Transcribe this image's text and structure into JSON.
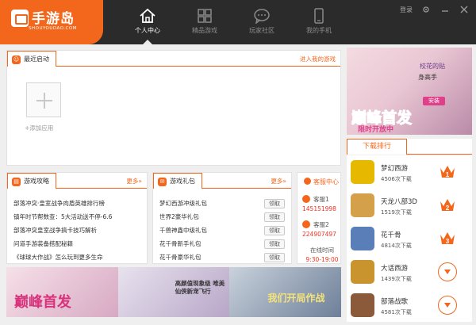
{
  "app": {
    "logo_text": "手游岛",
    "logo_sub": "SHOUYOUDAO.COM"
  },
  "nav": [
    {
      "label": "个人中心",
      "icon": "home-icon"
    },
    {
      "label": "精品游戏",
      "icon": "grid-icon"
    },
    {
      "label": "玩家社区",
      "icon": "chat-icon"
    },
    {
      "label": "我的手机",
      "icon": "phone-icon"
    }
  ],
  "window": {
    "login": "登录",
    "settings_icon": "gear-icon",
    "minimize_icon": "minimize-icon",
    "close_icon": "close-icon"
  },
  "recent": {
    "title": "最近启动",
    "link": "进入我的游戏",
    "add_label": "+添加应用"
  },
  "guide": {
    "title": "游戏攻略",
    "more": "更多»",
    "items": [
      "部落冲突·皇室战争肉盾英雄排行榜",
      "镇年时节帮数查：5大活动送不停-6.6",
      "部落冲突皇室战争搞卡技巧解析",
      "问道手游装备搭配秘籍",
      "《球球大作战》怎么玩到更多生命"
    ]
  },
  "gift": {
    "title": "游戏礼包",
    "more": "更多»",
    "get_label": "领取",
    "items": [
      "梦幻西游冲级礼包",
      "世界2豪华礼包",
      "千兽神鑫中级礼包",
      "花千骨新手礼包",
      "花千骨豪华礼包"
    ]
  },
  "service": {
    "title": "客服中心",
    "qq1_label": "客服1",
    "qq1_num": "145151998",
    "qq2_label": "客服2",
    "qq2_num": "224907497",
    "online_label": "在线时间",
    "online_hours": "9:30-19:00"
  },
  "ad": {
    "title": "巅峰首发",
    "sub": "限时开放中",
    "side_title": "校花的贴",
    "side_sub": "身高手",
    "btn": "安装"
  },
  "banners": [
    {
      "caption": "巅峰首发"
    },
    {
      "caption": "高颜值现象级 唯美仙侠新宠飞行"
    },
    {
      "caption": "我们开局作战"
    }
  ],
  "rank": {
    "title": "下载排行",
    "items": [
      {
        "name": "梦幻西游",
        "downloads": "4506次下载",
        "color": "#e6b800",
        "badge": "1"
      },
      {
        "name": "天龙八部3D",
        "downloads": "1519次下载",
        "color": "#d4a04a",
        "badge": "2"
      },
      {
        "name": "花千骨",
        "downloads": "4814次下载",
        "color": "#5a7fb8",
        "badge": "3"
      },
      {
        "name": "大话西游",
        "downloads": "1439次下载",
        "color": "#c9932e",
        "badge": ""
      },
      {
        "name": "部落战歌",
        "downloads": "4581次下载",
        "color": "#8a5a3a",
        "badge": ""
      }
    ]
  },
  "colors": {
    "accent": "#f3671c",
    "header_bg": "#2b2b2b",
    "number_red": "#e32"
  }
}
